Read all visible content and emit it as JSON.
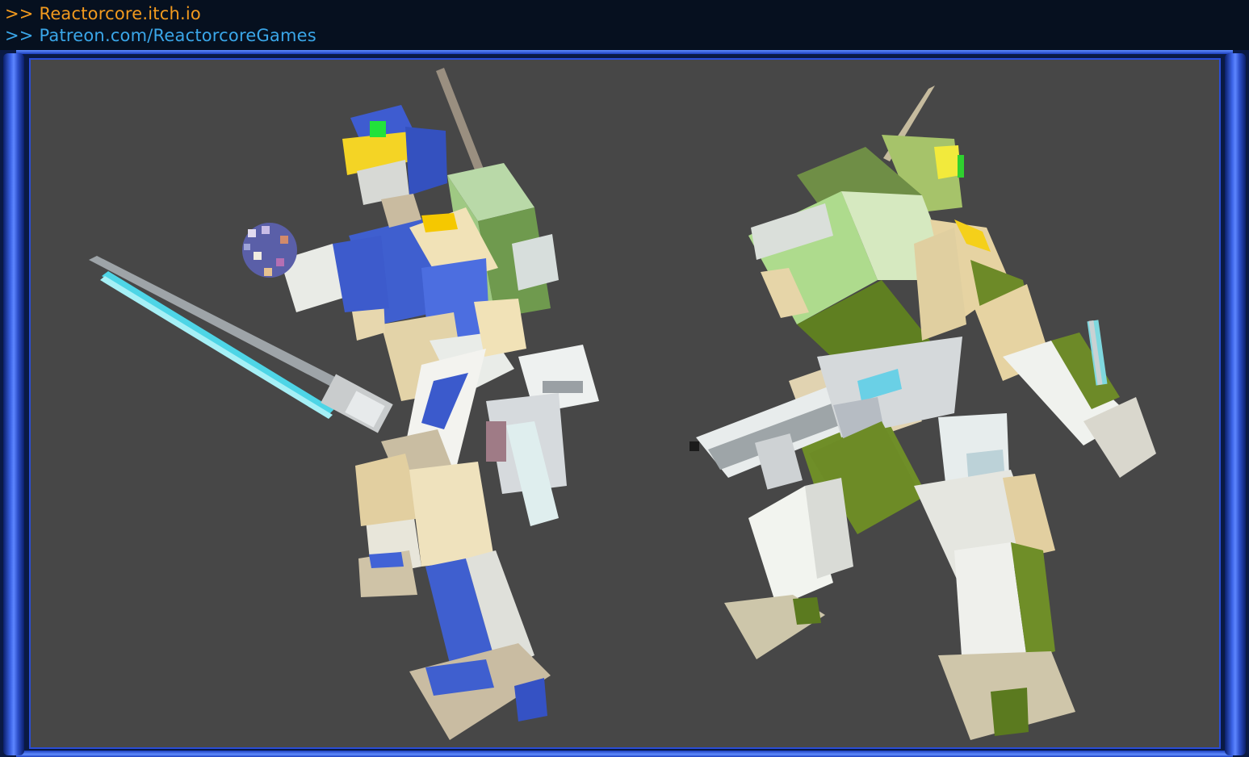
{
  "header": {
    "link_itch": ">> Reactorcore.itch.io",
    "link_patreon": ">> Patreon.com/ReactorcoreGames"
  },
  "colors": {
    "background": "#474747",
    "frame": "#2f5be0",
    "link_orange": "#f29a1e",
    "link_blue": "#3aa6e8"
  },
  "scene": {
    "models": [
      "blue-mech-with-energy-sword",
      "green-mech-with-rifle"
    ]
  }
}
